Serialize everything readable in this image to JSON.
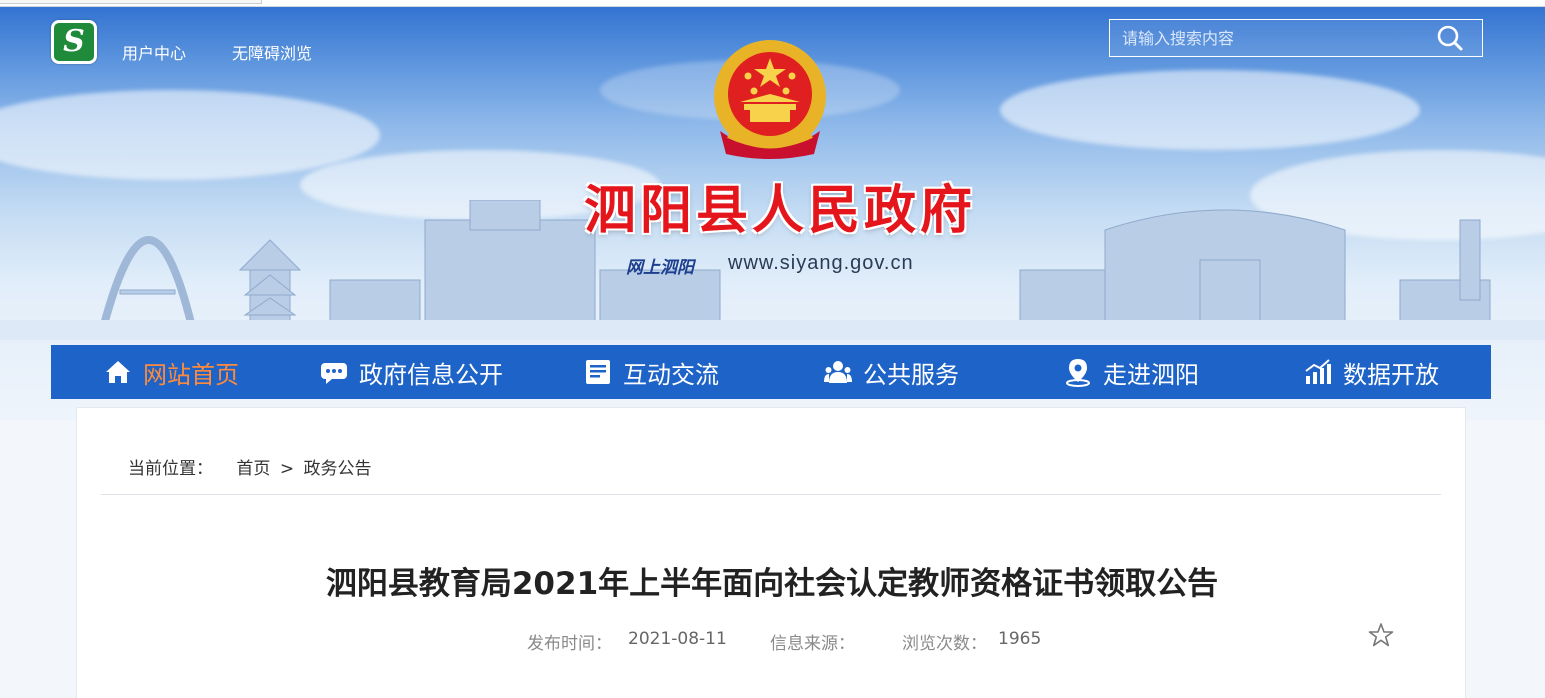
{
  "header": {
    "logo_letter": "S",
    "top_links": [
      "用户中心",
      "无障碍浏览"
    ],
    "search": {
      "placeholder": "请输入搜索内容"
    },
    "site_title": "泗阳县人民政府",
    "subtitle_script": "网上泗阳",
    "subtitle_url": "www.siyang.gov.cn"
  },
  "nav": {
    "items": [
      {
        "label": "网站首页",
        "icon": "home-icon",
        "active": true
      },
      {
        "label": "政府信息公开",
        "icon": "chat-icon",
        "active": false
      },
      {
        "label": "互动交流",
        "icon": "document-icon",
        "active": false
      },
      {
        "label": "公共服务",
        "icon": "people-icon",
        "active": false
      },
      {
        "label": "走进泗阳",
        "icon": "location-icon",
        "active": false
      },
      {
        "label": "数据开放",
        "icon": "bar-chart-icon",
        "active": false
      }
    ],
    "active_color": "#ff8a3c",
    "bg_color": "#1e63c8"
  },
  "breadcrumb": {
    "prefix": "当前位置：",
    "home": "首页",
    "separator": ">",
    "current": "政务公告"
  },
  "article": {
    "title": "泗阳县教育局2021年上半年面向社会认定教师资格证书领取公告",
    "publish_label": "发布时间：",
    "publish_date": "2021-08-11",
    "source_label": "信息来源：",
    "source_value": "",
    "views_label": "浏览次数：",
    "views_count": "1965"
  }
}
